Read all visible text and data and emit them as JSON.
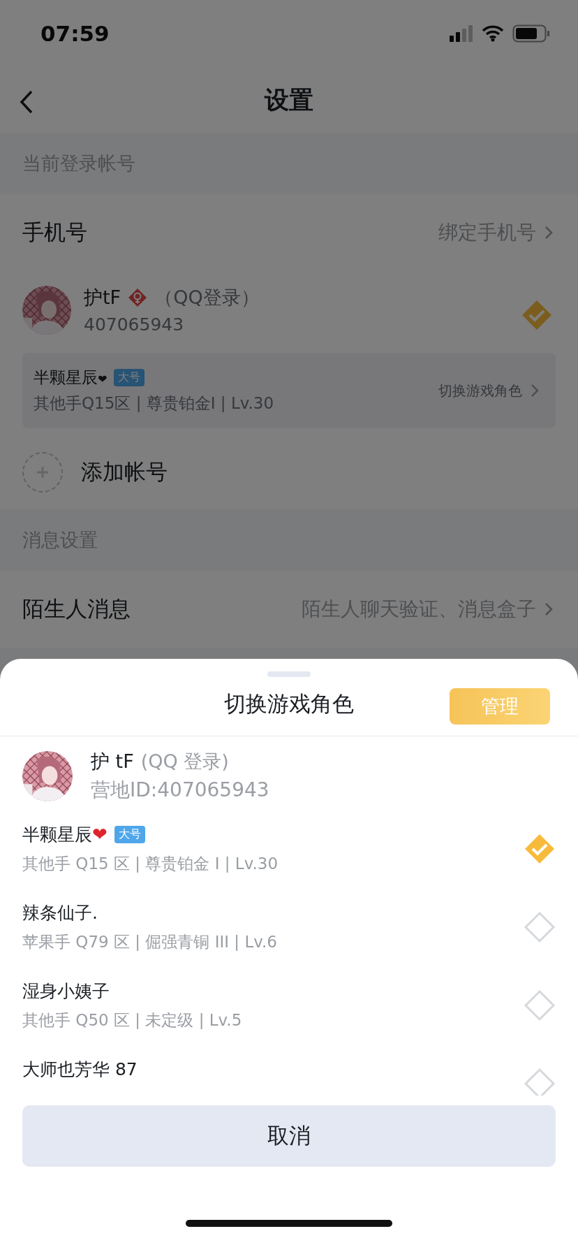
{
  "status_bar": {
    "time": "07:59"
  },
  "nav": {
    "title": "设置"
  },
  "sections": [
    {
      "header": "当前登录帐号",
      "items": [
        {
          "kind": "link",
          "label": "手机号",
          "value": "绑定手机号"
        },
        {
          "kind": "account",
          "name": "护tF",
          "login": "（QQ登录）",
          "id": "407065943",
          "selected": true,
          "role": {
            "name": "半颗星辰",
            "emoji": "❤",
            "tag": "大号",
            "detail": "其他手Q15区 | 尊贵铂金I | Lv.30",
            "action": "切换游戏角色"
          }
        },
        {
          "kind": "add",
          "label": "添加帐号"
        }
      ]
    },
    {
      "header": "消息设置",
      "items": [
        {
          "kind": "link",
          "label": "陌生人消息",
          "value": "陌生人聊天验证、消息盒子"
        }
      ]
    }
  ],
  "sheet": {
    "title": "切换游戏角色",
    "manage_button": "管理",
    "profile": {
      "name": "护 tF",
      "login": "(QQ 登录)",
      "id": "营地ID:407065943"
    },
    "roles": [
      {
        "name": "半颗星辰",
        "emoji": "❤",
        "tag": "大号",
        "detail": "其他手 Q15 区 | 尊贵铂金 I | Lv.30",
        "selected": true
      },
      {
        "name": "辣条仙子.",
        "detail": "苹果手 Q79 区 | 倔强青铜 III | Lv.6",
        "selected": false
      },
      {
        "name": "湿身小姨子",
        "detail": "其他手 Q50 区 | 未定级 | Lv.5",
        "selected": false
      },
      {
        "name": "大师也芳华 87",
        "selected": false
      }
    ],
    "cancel_button": "取消"
  }
}
